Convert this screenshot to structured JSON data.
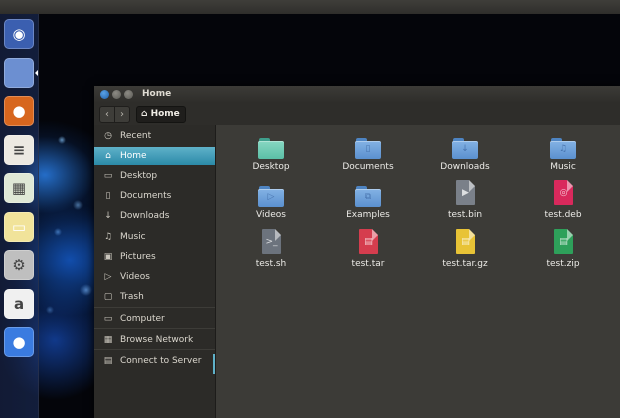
{
  "window": {
    "title": "Home"
  },
  "toolbar": {
    "back_icon": "chevron-left-icon",
    "forward_icon": "chevron-right-icon",
    "path_label": "Home"
  },
  "launcher": {
    "items": [
      {
        "name": "dash",
        "icon": "ubuntu-logo-icon",
        "color": "#3b5fb0"
      },
      {
        "name": "files",
        "icon": "files-icon",
        "color": "#6c8fd1",
        "running": true
      },
      {
        "name": "firefox",
        "icon": "firefox-icon",
        "color": "#d7661e"
      },
      {
        "name": "writer",
        "icon": "writer-icon",
        "color": "#ece9e2"
      },
      {
        "name": "calc",
        "icon": "calc-icon",
        "color": "#dfe8d6"
      },
      {
        "name": "impress",
        "icon": "impress-icon",
        "color": "#f1e39a"
      },
      {
        "name": "settings",
        "icon": "gear-icon",
        "color": "#bfbfbf"
      },
      {
        "name": "amazon",
        "icon": "amazon-icon",
        "color": "#f0f0f0"
      },
      {
        "name": "toggle",
        "icon": "toggle-icon",
        "color": "#3a7be0"
      }
    ]
  },
  "sidebar": {
    "items": [
      {
        "label": "Recent",
        "icon": "clock-icon",
        "glyph": "◷"
      },
      {
        "label": "Home",
        "icon": "home-icon",
        "glyph": "⌂",
        "active": true
      },
      {
        "label": "Desktop",
        "icon": "desktop-icon",
        "glyph": "▭"
      },
      {
        "label": "Documents",
        "icon": "documents-icon",
        "glyph": "▯"
      },
      {
        "label": "Downloads",
        "icon": "downloads-icon",
        "glyph": "↓"
      },
      {
        "label": "Music",
        "icon": "music-icon",
        "glyph": "♫"
      },
      {
        "label": "Pictures",
        "icon": "pictures-icon",
        "glyph": "▣"
      },
      {
        "label": "Videos",
        "icon": "videos-icon",
        "glyph": "▷"
      },
      {
        "label": "Trash",
        "icon": "trash-icon",
        "glyph": "▢"
      },
      {
        "label": "Computer",
        "icon": "computer-icon",
        "glyph": "▭"
      },
      {
        "label": "Browse Network",
        "icon": "network-icon",
        "glyph": "▦"
      },
      {
        "label": "Connect to Server",
        "icon": "server-icon",
        "glyph": "▤"
      }
    ]
  },
  "files": [
    {
      "label": "Desktop",
      "kind": "folder",
      "variant": "teal",
      "icon": "desktop-folder-icon"
    },
    {
      "label": "Documents",
      "kind": "folder",
      "icon": "documents-folder-icon",
      "emblem": "▯"
    },
    {
      "label": "Downloads",
      "kind": "folder",
      "icon": "downloads-folder-icon",
      "emblem": "↓"
    },
    {
      "label": "Music",
      "kind": "folder",
      "icon": "music-folder-icon",
      "emblem": "♫"
    },
    {
      "label": "Videos",
      "kind": "folder",
      "icon": "videos-folder-icon",
      "emblem": "▷"
    },
    {
      "label": "Examples",
      "kind": "folder",
      "icon": "examples-folder-icon",
      "emblem": "⧉"
    },
    {
      "label": "test.bin",
      "kind": "doc",
      "icon": "binary-file-icon",
      "color": "#7a8089",
      "mark": "▶"
    },
    {
      "label": "test.deb",
      "kind": "doc",
      "icon": "deb-package-icon",
      "color": "#d9295c",
      "mark": "◎"
    },
    {
      "label": "test.sh",
      "kind": "doc",
      "icon": "script-file-icon",
      "color": "#6c737d",
      "mark": ">_"
    },
    {
      "label": "test.tar",
      "kind": "doc",
      "icon": "tar-archive-icon",
      "color": "#d53d4e",
      "mark": "▤"
    },
    {
      "label": "test.tar.gz",
      "kind": "doc",
      "icon": "targz-archive-icon",
      "color": "#e8c336",
      "mark": "▤"
    },
    {
      "label": "test.zip",
      "kind": "doc",
      "icon": "zip-archive-icon",
      "color": "#2ea05a",
      "mark": "▤"
    }
  ]
}
